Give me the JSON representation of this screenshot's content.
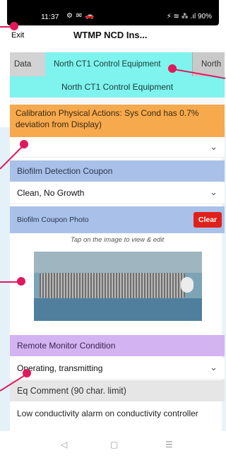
{
  "status_bar": {
    "time": "11:37",
    "left_icons": "⚙ ✉ 🚗",
    "right_icons": "⚡ ≋ ⁂ .ıl 90%"
  },
  "header": {
    "exit_label": "Exit",
    "title": "WTMP NCD Ins..."
  },
  "tabs": [
    {
      "label": "Data",
      "active": false
    },
    {
      "label": "North CT1 Control Equipment",
      "active": true
    },
    {
      "label": "North",
      "active": false
    }
  ],
  "section_title": "North CT1 Control Equipment",
  "calibration": {
    "label": "Calibration Physical Actions: Sys Cond has 0.7% deviation from Display)",
    "value": ""
  },
  "biofilm": {
    "header": "Biofilm Detection Coupon",
    "value": "Clean, No Growth"
  },
  "photo": {
    "header": "Biofilm Coupon Photo",
    "clear_label": "Clear",
    "hint": "Tap on the image to view & edit"
  },
  "remote": {
    "header": "Remote Monitor Condition",
    "value": "Operating, transmitting"
  },
  "comment": {
    "header": "Eq Comment (90 char. limit)",
    "text": "Low conductivity alarm on conductivity controller"
  },
  "nav": {
    "back": "◁",
    "home": "▢",
    "recent": "☰"
  },
  "colors": {
    "accent_cyan": "#7ff3ee",
    "orange": "#f7a94d",
    "blue_header": "#a9c1e8",
    "purple_header": "#d4b3f2",
    "clear_red": "#e0201a",
    "annotation_pink": "#e0195a"
  }
}
